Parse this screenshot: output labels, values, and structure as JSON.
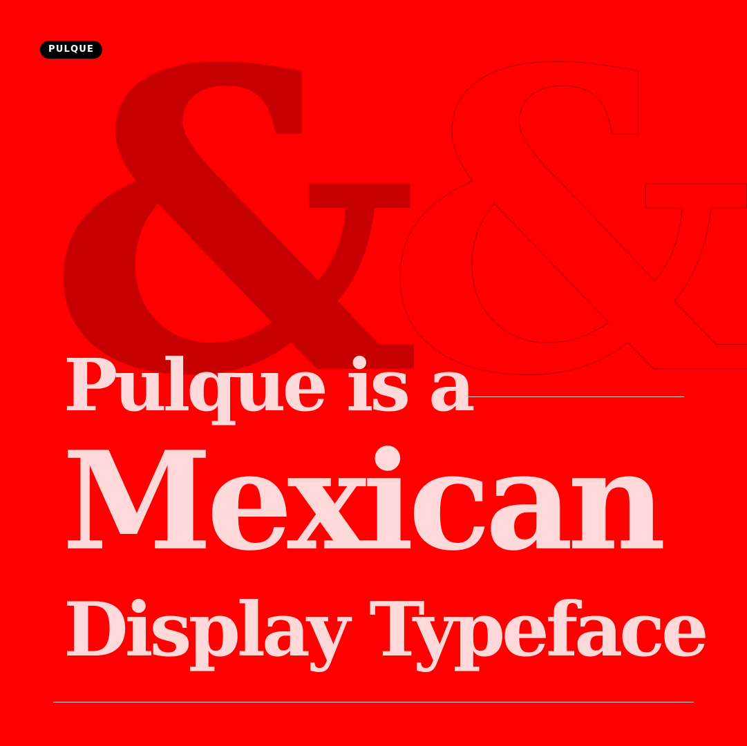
{
  "badge": {
    "label": "PULQUE"
  },
  "glyph": {
    "solid": "&",
    "outline": "&"
  },
  "headline": {
    "line1": "Pulque is a",
    "line2": "Mexican",
    "line3": "Display Typeface"
  },
  "colors": {
    "background": "#ff0000",
    "solid_glyph": "#c60000",
    "outline_glyph": "#b80000",
    "headline_text": "#ffd9d9",
    "badge_background": "#000000",
    "badge_text": "#ffffff"
  }
}
